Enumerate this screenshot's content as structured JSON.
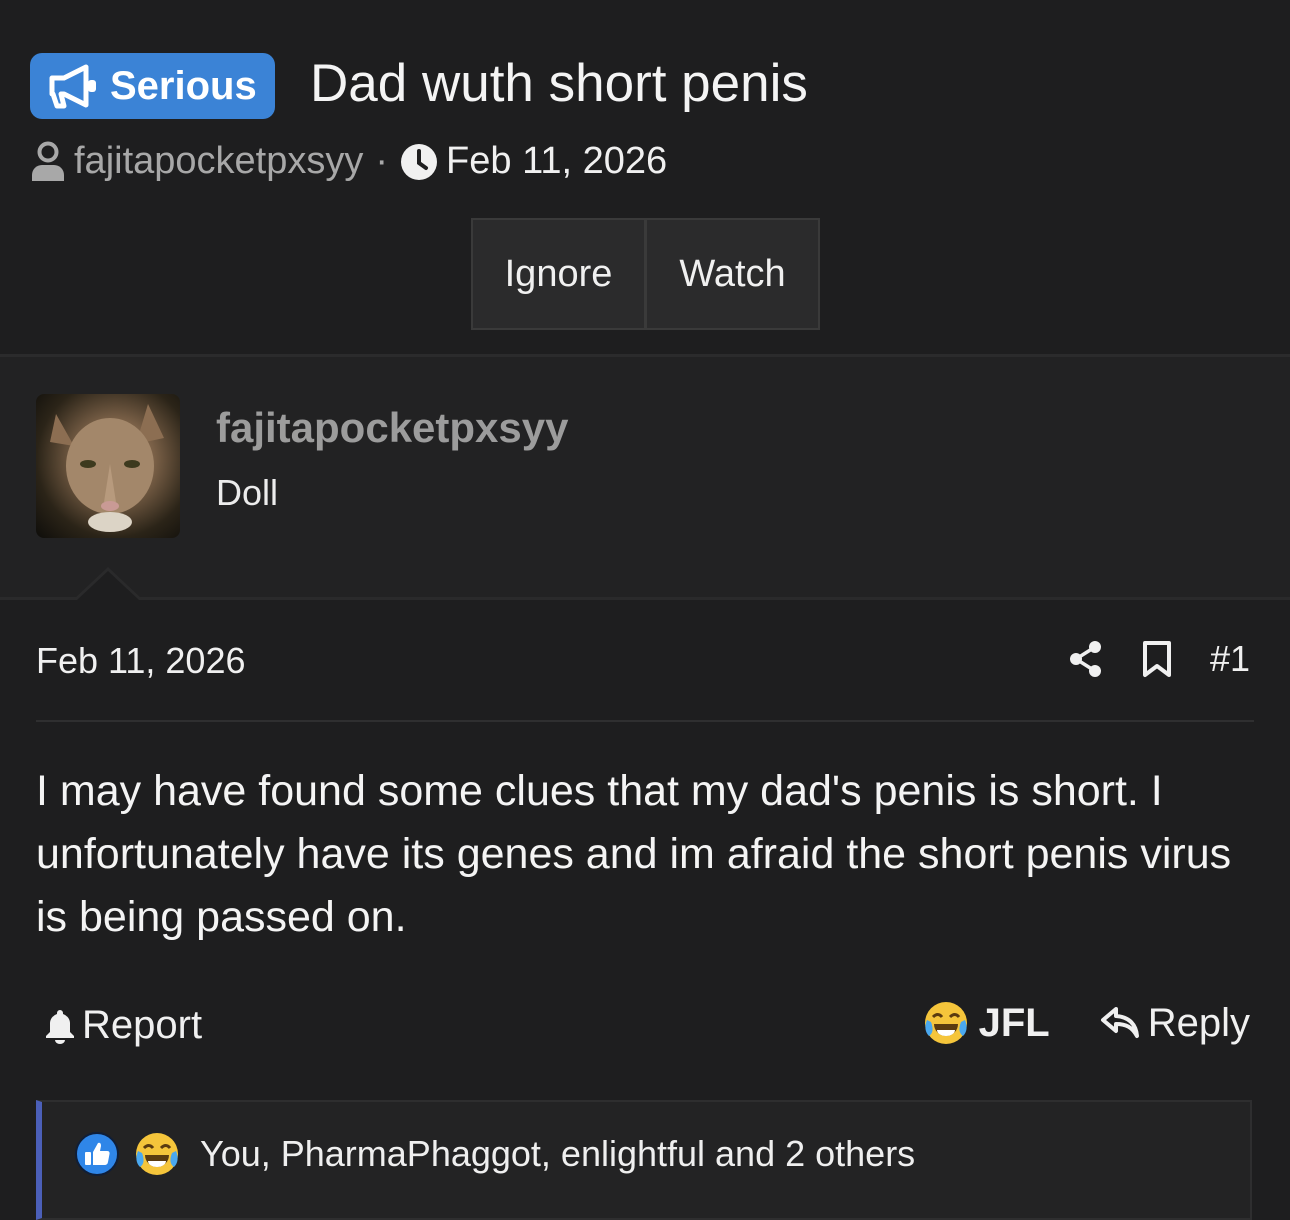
{
  "thread": {
    "prefix": "Serious",
    "title": "Dad wuth short penis",
    "author": "fajitapocketpxsyy",
    "separator": "·",
    "date": "Feb 11, 2026"
  },
  "actions": {
    "ignore": "Ignore",
    "watch": "Watch"
  },
  "post": {
    "username": "fajitapocketpxsyy",
    "user_title": "Doll",
    "date": "Feb 11, 2026",
    "number": "#1",
    "body": "I may have found some clues that my dad's penis is short. I unfortunately have its genes and im afraid the short penis virus is being passed on.",
    "report_label": "Report",
    "reaction_label": "JFL",
    "reply_label": "Reply",
    "reactions_summary": "You, PharmaPhaggot, enlightful and 2 others"
  },
  "colors": {
    "background": "#1e1e1f",
    "prefix_badge": "#3b83d6",
    "reaction_accent": "#4b5fb8"
  },
  "icons": [
    "megaphone-icon",
    "user-icon",
    "clock-icon",
    "share-icon",
    "bookmark-icon",
    "bell-icon",
    "laughing-crying-emoji-icon",
    "reply-arrow-icon",
    "thumbs-up-icon"
  ]
}
